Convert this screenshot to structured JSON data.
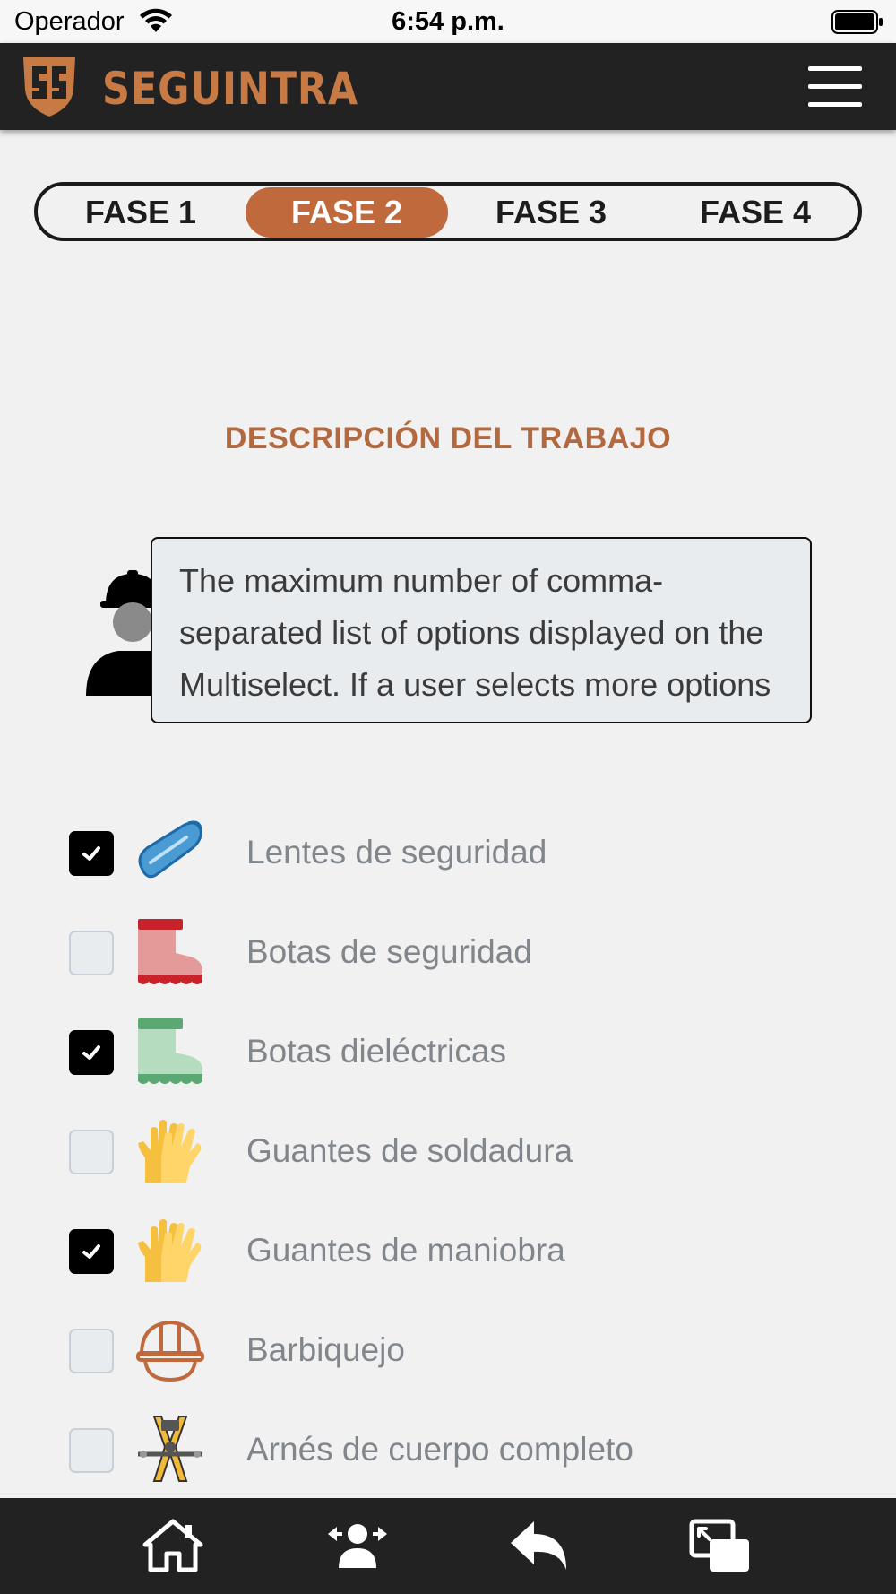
{
  "status_bar": {
    "carrier": "Operador",
    "time": "6:54 p.m."
  },
  "header": {
    "logo_text": "SEGUINTRA",
    "brand_color": "#c87a45"
  },
  "phases": {
    "active_index": 1,
    "tabs": [
      {
        "label": "FASE 1"
      },
      {
        "label": "FASE 2"
      },
      {
        "label": "FASE 3"
      },
      {
        "label": "FASE 4"
      }
    ]
  },
  "section": {
    "title": "DESCRIPCIÓN DEL TRABAJO"
  },
  "description": {
    "text": "The maximum number of comma-separated list of options displayed on the Multiselect. If a user selects more options than the value of this property"
  },
  "equipment": {
    "items": [
      {
        "label": "Lentes de seguridad",
        "checked": true,
        "icon": "safety-glasses-icon"
      },
      {
        "label": "Botas de seguridad",
        "checked": false,
        "icon": "red-boot-icon"
      },
      {
        "label": "Botas dieléctricas",
        "checked": true,
        "icon": "green-boot-icon"
      },
      {
        "label": "Guantes de soldadura",
        "checked": false,
        "icon": "gloves-icon"
      },
      {
        "label": "Guantes de maniobra",
        "checked": true,
        "icon": "gloves-icon"
      },
      {
        "label": "Barbiquejo",
        "checked": false,
        "icon": "hard-hat-icon"
      },
      {
        "label": "Arnés de cuerpo completo",
        "checked": false,
        "icon": "harness-icon"
      }
    ]
  },
  "bottom_nav": {
    "items": [
      {
        "icon": "home-icon"
      },
      {
        "icon": "user-transfer-icon"
      },
      {
        "icon": "reply-back-icon"
      },
      {
        "icon": "window-switch-icon"
      }
    ]
  },
  "colors": {
    "accent": "#c0693d",
    "header_bg": "#222222",
    "page_bg": "#f2f1f1"
  }
}
